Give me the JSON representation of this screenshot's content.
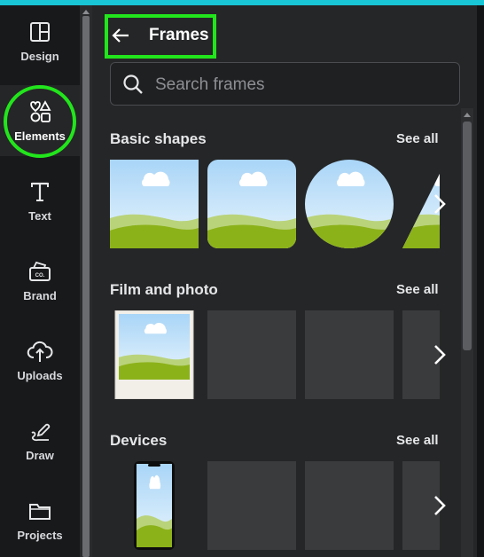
{
  "sidebar": {
    "items": [
      {
        "label": "Design",
        "icon": "design-icon"
      },
      {
        "label": "Elements",
        "icon": "elements-icon"
      },
      {
        "label": "Text",
        "icon": "text-icon"
      },
      {
        "label": "Brand",
        "icon": "brand-icon"
      },
      {
        "label": "Uploads",
        "icon": "uploads-icon"
      },
      {
        "label": "Draw",
        "icon": "draw-icon"
      },
      {
        "label": "Projects",
        "icon": "projects-icon"
      }
    ],
    "active": "Elements",
    "brand_logo_text": "CO."
  },
  "header": {
    "title": "Frames",
    "back_icon": "arrow-left-icon"
  },
  "search": {
    "placeholder": "Search frames",
    "value": ""
  },
  "sections": [
    {
      "title": "Basic shapes",
      "see_all": "See all",
      "items": [
        "square-frame",
        "rounded-square-frame",
        "circle-frame",
        "triangle-frame"
      ]
    },
    {
      "title": "Film and photo",
      "see_all": "See all",
      "items": [
        "polaroid-frame",
        "placeholder",
        "placeholder",
        "placeholder"
      ]
    },
    {
      "title": "Devices",
      "see_all": "See all",
      "items": [
        "phone-frame",
        "placeholder",
        "placeholder",
        "placeholder"
      ]
    }
  ],
  "colors": {
    "highlight": "#22e51c",
    "top_accent": "#18c6d6",
    "panel_bg": "#252627",
    "sidebar_bg": "#18191b",
    "sky_top": "#a9d5f7",
    "grass": "#8cb21a"
  }
}
